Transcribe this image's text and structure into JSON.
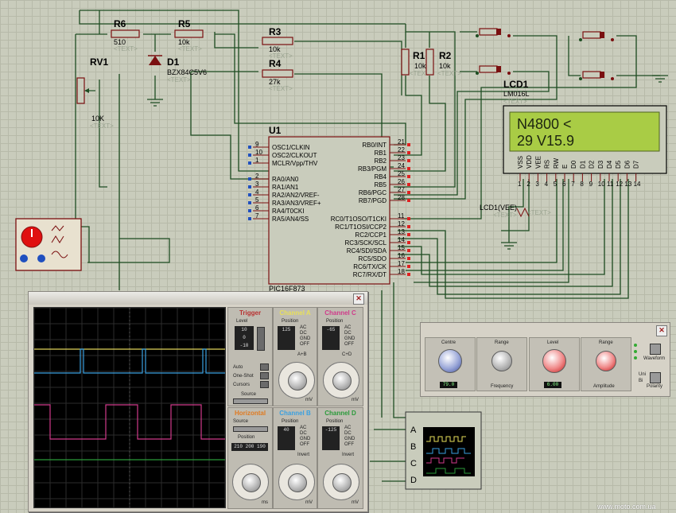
{
  "schematic": {
    "resistors": {
      "r6": {
        "name": "R6",
        "value": "510",
        "ph": "<TEXT>"
      },
      "r5": {
        "name": "R5",
        "value": "10k",
        "ph": "<TEXT>"
      },
      "r3": {
        "name": "R3",
        "value": "10k",
        "ph": "<TEXT>"
      },
      "r4": {
        "name": "R4",
        "value": "27k",
        "ph": "<TEXT>"
      },
      "r1": {
        "name": "R1",
        "value": "10k",
        "ph": "<TEXT>"
      },
      "r2": {
        "name": "R2",
        "value": "10k",
        "ph": "<TEXT>"
      }
    },
    "rv1": {
      "name": "RV1",
      "value": "10K",
      "ph": "<TEXT>"
    },
    "d1": {
      "name": "D1",
      "value": "BZX84C5V6",
      "ph": "<TEXT>"
    },
    "lcd1": {
      "name": "LCD1",
      "model": "LM016L",
      "ph": "<TEXT>",
      "line1": "N4800  <",
      "line2": "29 V15.9",
      "pins": [
        "VSS",
        "VDD",
        "VEE",
        "RS",
        "RW",
        "E",
        "D0",
        "D1",
        "D2",
        "D3",
        "D4",
        "D5",
        "D6",
        "D7"
      ],
      "pin_nums": [
        "1",
        "2",
        "3",
        "4",
        "5",
        "6",
        "7",
        "8",
        "9",
        "10",
        "11",
        "12",
        "13",
        "14"
      ]
    },
    "lcd_vee": {
      "label": "LCD1(VEE)",
      "ph": "<TEXT>",
      "tag": "<TEXT>"
    },
    "u1": {
      "name": "U1",
      "part": "PIC16F873",
      "left_pins": [
        {
          "num": "9",
          "label": "OSC1/CLKIN"
        },
        {
          "num": "10",
          "label": "OSC2/CLKOUT"
        },
        {
          "num": "1",
          "label": "MCLR/Vpp/THV"
        },
        {
          "num": "2",
          "label": "RA0/AN0"
        },
        {
          "num": "3",
          "label": "RA1/AN1"
        },
        {
          "num": "4",
          "label": "RA2/AN2/VREF-"
        },
        {
          "num": "5",
          "label": "RA3/AN3/VREF+"
        },
        {
          "num": "6",
          "label": "RA4/T0CKI"
        },
        {
          "num": "7",
          "label": "RA5/AN4/SS"
        }
      ],
      "right_pins": [
        {
          "num": "21",
          "label": "RB0/INT"
        },
        {
          "num": "22",
          "label": "RB1"
        },
        {
          "num": "23",
          "label": "RB2"
        },
        {
          "num": "24",
          "label": "RB3/PGM"
        },
        {
          "num": "25",
          "label": "RB4"
        },
        {
          "num": "26",
          "label": "RB5"
        },
        {
          "num": "27",
          "label": "RB6/PGC"
        },
        {
          "num": "28",
          "label": "RB7/PGD"
        },
        {
          "num": "11",
          "label": "RC0/T1OSO/T1CKI"
        },
        {
          "num": "12",
          "label": "RC1/T1OSI/CCP2"
        },
        {
          "num": "13",
          "label": "RC2/CCP1"
        },
        {
          "num": "14",
          "label": "RC3/SCK/SCL"
        },
        {
          "num": "15",
          "label": "RC4/SDI/SDA"
        },
        {
          "num": "16",
          "label": "RC5/SDO"
        },
        {
          "num": "17",
          "label": "RC6/TX/CK"
        },
        {
          "num": "18",
          "label": "RC7/RX/DT"
        }
      ]
    }
  },
  "oscilloscope": {
    "trigger_title": "Trigger",
    "level_label": "Level",
    "auto_label": "Auto",
    "oneshot_label": "One-Shot",
    "cursors_label": "Cursors",
    "source_label": "Source",
    "channel_a": {
      "title": "Channel A",
      "color": "#e8e05a",
      "position_label": "Position",
      "value": "125",
      "unit": "mV"
    },
    "channel_b": {
      "title": "Channel B",
      "color": "#3aa0e0",
      "position_label": "Position",
      "value": "40",
      "unit": "mV"
    },
    "channel_c": {
      "title": "Channel C",
      "color": "#d03a8a",
      "position_label": "Position",
      "value": "-65",
      "unit": "mV"
    },
    "channel_d": {
      "title": "Channel D",
      "color": "#2a9a3a",
      "position_label": "Position",
      "value": "-125",
      "unit": "mV"
    },
    "horizontal": {
      "title": "Horizontal",
      "color": "#e07a20",
      "source_label": "Source",
      "position_label": "Position",
      "scale": "210   200   190",
      "unit": "ms"
    },
    "coupling": [
      "AC",
      "DC",
      "GND",
      "OFF"
    ],
    "invert_label": "Invert",
    "ab_label": "A+B",
    "cd_label": "C+D"
  },
  "function_generator": {
    "centre_label": "Centre",
    "range_label": "Range",
    "level_label": "Level",
    "frequency_label": "Frequency",
    "amplitude_label": "Amplitude",
    "centre_display": "79.0",
    "level_display": "6.00",
    "waveform_label": "Waveform",
    "polarity_label": "Polarity",
    "uni_label": "Uni",
    "bi_label": "Bi"
  },
  "logic_probe": {
    "channels": [
      "A",
      "B",
      "C",
      "D"
    ]
  },
  "watermark": "www.moto.com.ua"
}
